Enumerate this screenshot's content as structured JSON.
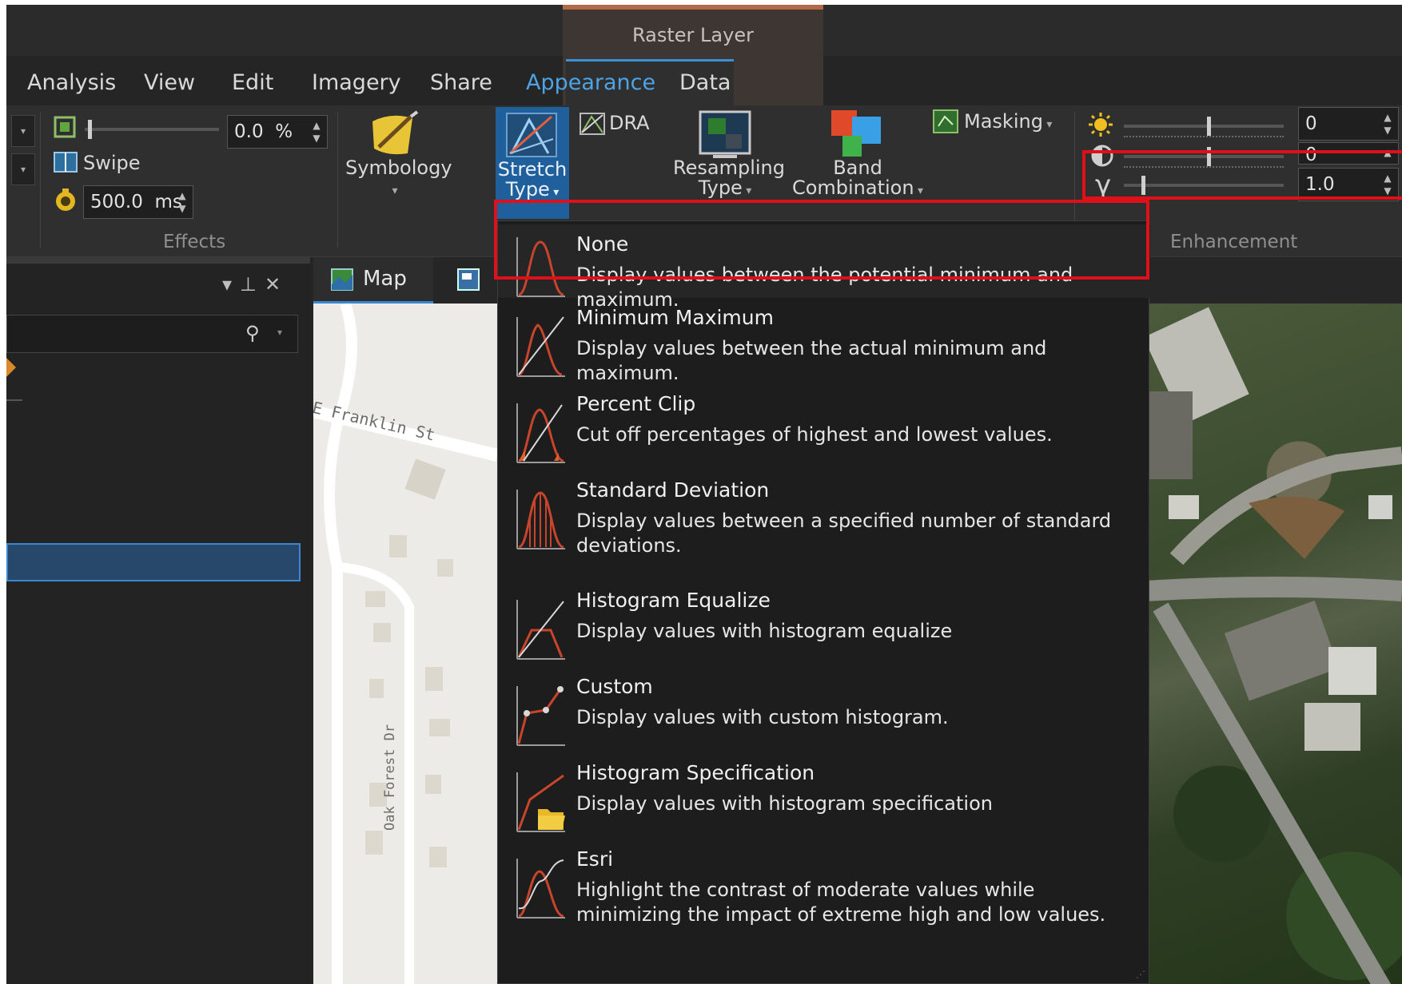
{
  "context_group": {
    "label": "Raster Layer"
  },
  "tabs": [
    {
      "label": "Analysis"
    },
    {
      "label": "View"
    },
    {
      "label": "Edit"
    },
    {
      "label": "Imagery"
    },
    {
      "label": "Share"
    },
    {
      "label": "Appearance",
      "active": true
    },
    {
      "label": "Data"
    }
  ],
  "effects": {
    "transparency_value": "0.0",
    "transparency_unit": "%",
    "swipe_label": "Swipe",
    "flicker_value": "500.0",
    "flicker_unit": "ms",
    "group_label": "Effects"
  },
  "ribbon": {
    "symbology_label": "Symbology",
    "stretch_line1": "Stretch",
    "stretch_line2": "Type",
    "dra_label": "DRA",
    "resampling_line1": "Resampling",
    "resampling_line2": "Type",
    "band_line1": "Band",
    "band_line2": "Combination",
    "masking_label": "Masking"
  },
  "enhancement": {
    "brightness_value": "0",
    "contrast_value": "0",
    "gamma_symbol": "γ",
    "gamma_value": "1.0",
    "group_label": "Enhancement"
  },
  "map_tab": {
    "label": "Map"
  },
  "map_labels": {
    "street1": "E Franklin St",
    "street2": "Oak Forest Dr"
  },
  "stretch_menu": [
    {
      "title": "None",
      "desc": "Display values between the potential minimum and maximum.",
      "icon": "stretch-none-icon"
    },
    {
      "title": "Minimum Maximum",
      "desc": "Display values between the actual minimum and maximum.",
      "icon": "stretch-minmax-icon"
    },
    {
      "title": "Percent Clip",
      "desc": "Cut off percentages of highest and lowest values.",
      "icon": "stretch-percentclip-icon"
    },
    {
      "title": "Standard Deviation",
      "desc": "Display values between a specified number of standard deviations.",
      "icon": "stretch-stddev-icon"
    },
    {
      "title": "Histogram Equalize",
      "desc": "Display values with histogram equalize",
      "icon": "stretch-equalize-icon"
    },
    {
      "title": "Custom",
      "desc": "Display values with custom histogram.",
      "icon": "stretch-custom-icon"
    },
    {
      "title": "Histogram Specification",
      "desc": "Display values with histogram specification",
      "icon": "stretch-specification-icon"
    },
    {
      "title": "Esri",
      "desc": "Highlight the contrast of moderate values while minimizing the impact of extreme high and low values.",
      "icon": "stretch-esri-icon"
    }
  ],
  "colors": {
    "accent": "#3d8fd6",
    "highlight": "#e0101a",
    "stretch_curve": "#c8442a"
  }
}
